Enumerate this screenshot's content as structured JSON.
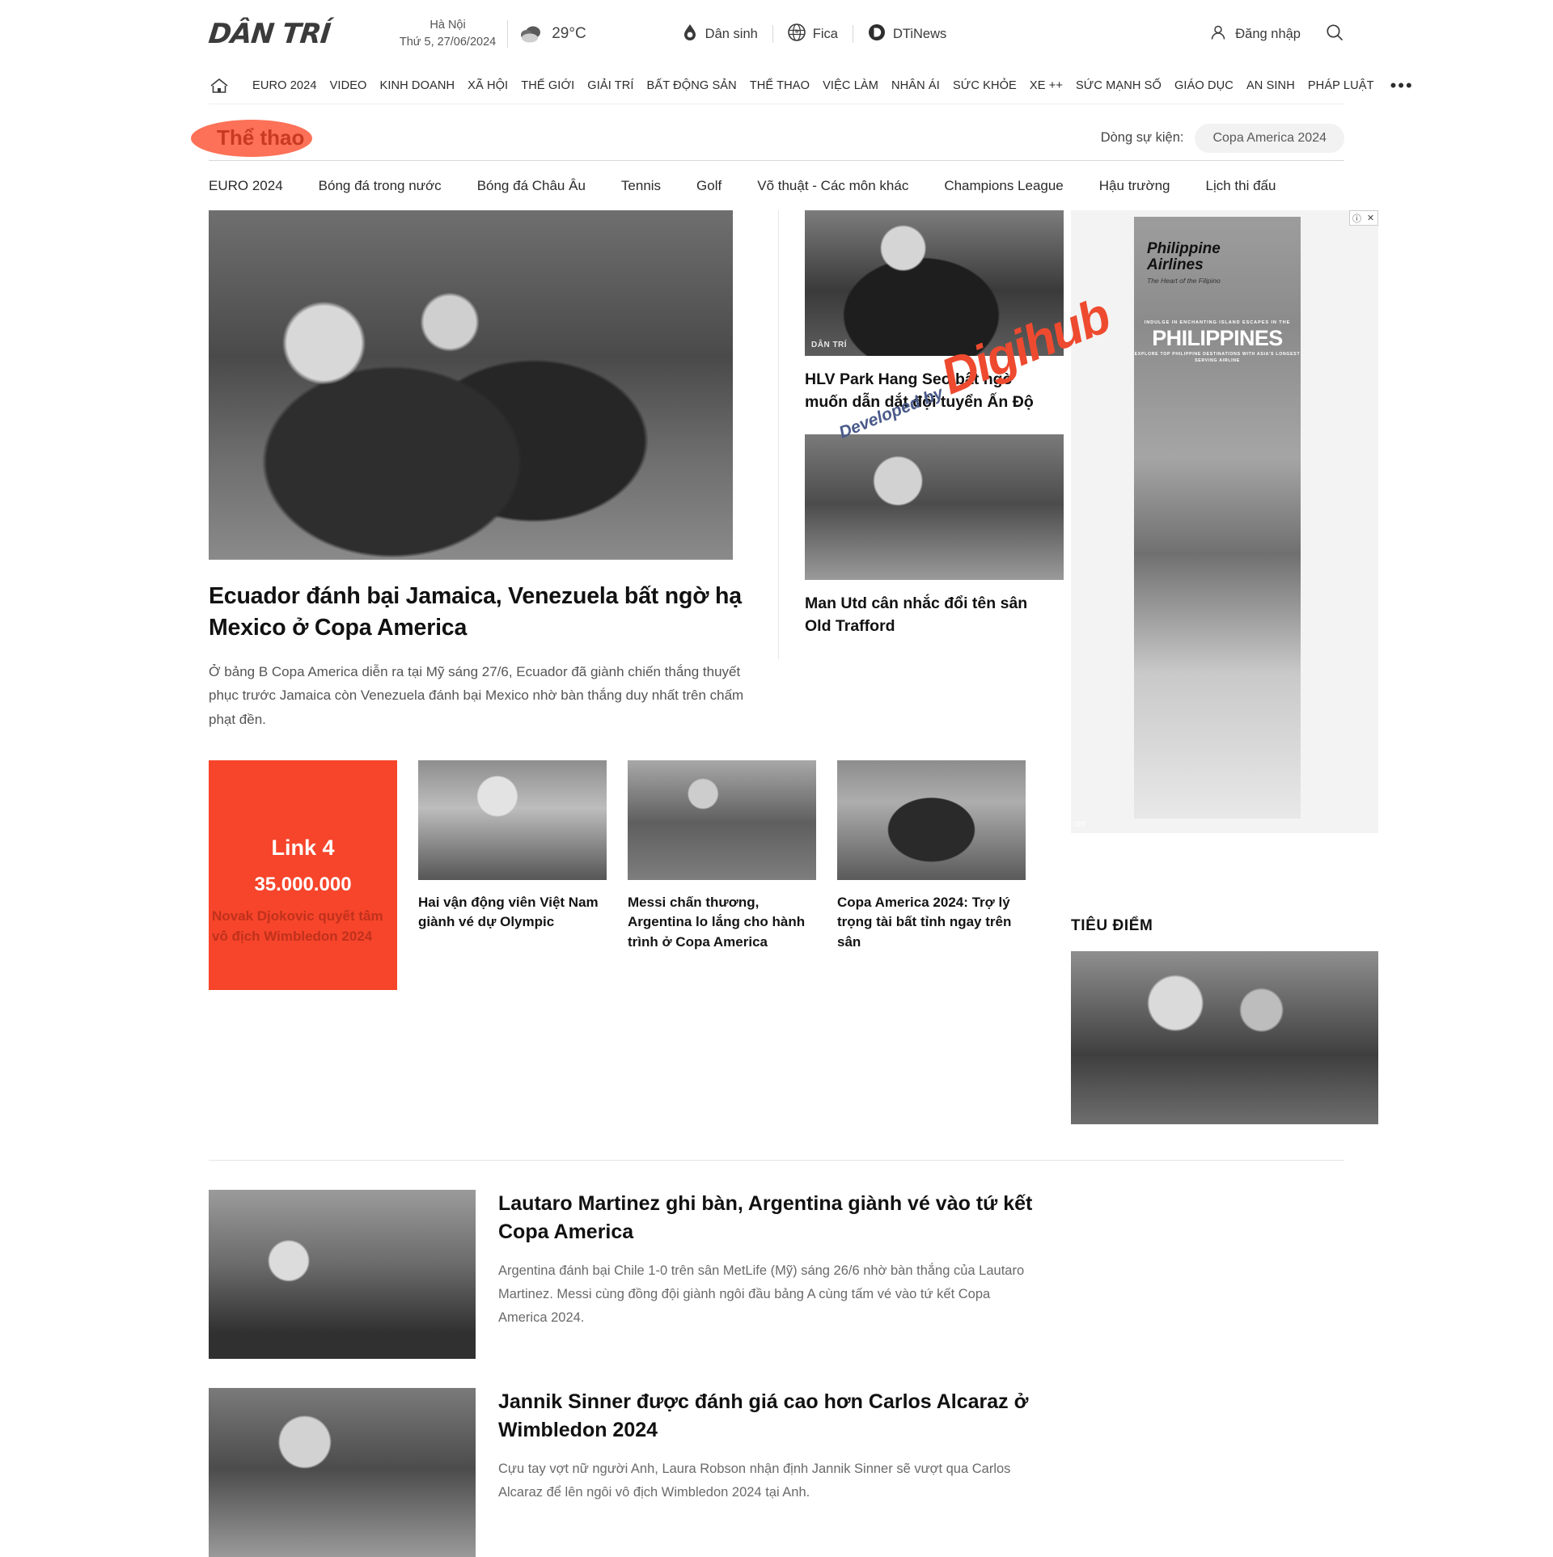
{
  "header": {
    "logo": "DÂN TRÍ",
    "weather": {
      "city": "Hà Nội",
      "date": "Thứ 5, 27/06/2024",
      "temp": "29°C",
      "icon": "cloud-icon"
    },
    "partners": [
      {
        "label": "Dân sinh",
        "icon": "dansinh-icon"
      },
      {
        "label": "Fica",
        "icon": "globe-icon"
      },
      {
        "label": "DTiNews",
        "icon": "dtinews-icon"
      }
    ],
    "login_label": "Đăng nhập",
    "login_icon": "user-icon",
    "search_icon": "search-icon"
  },
  "mainnav": {
    "home_icon": "home-icon",
    "items": [
      "EURO 2024",
      "VIDEO",
      "KINH DOANH",
      "XÃ HỘI",
      "THẾ GIỚI",
      "GIẢI TRÍ",
      "BẤT ĐỘNG SẢN",
      "THỂ THAO",
      "VIỆC LÀM",
      "NHÂN ÁI",
      "SỨC KHỎE",
      "XE ++",
      "SỨC MẠNH SỐ",
      "GIÁO DỤC",
      "AN SINH",
      "PHÁP LUẬT"
    ],
    "more": "•••"
  },
  "section": {
    "title": "Thể thao",
    "event_label": "Dòng sự kiện:",
    "event_chip": "Copa America 2024",
    "highlight_color": "#fb5232"
  },
  "subnav": {
    "items": [
      "EURO 2024",
      "Bóng đá trong nước",
      "Bóng đá Châu Âu",
      "Tennis",
      "Golf",
      "Võ thuật - Các môn khác",
      "Champions League",
      "Hậu trường",
      "Lịch thi đấu"
    ]
  },
  "hero": {
    "title": "Ecuador đánh bại Jamaica, Venezuela bất ngờ hạ Mexico ở Copa America",
    "sapo": "Ở bảng B Copa America diễn ra tại Mỹ sáng 27/6, Ecuador đã giành chiến thắng thuyết phục trước Jamaica còn Venezuela đánh bại Mexico nhờ bàn thắng duy nhất trên chấm phạt đền."
  },
  "mid_cards": [
    {
      "title": "HLV Park Hang Seo bất ngờ muốn dẫn dắt đội tuyển Ấn Độ",
      "badge": "DÂN TRÍ"
    },
    {
      "title": "Man Utd cân nhắc đổi tên sân Old Trafford",
      "badge": ""
    }
  ],
  "ad": {
    "info_icon": "info-icon",
    "close_icon": "close-icon",
    "brand_line1": "Philippine",
    "brand_line2": "Airlines",
    "tagline": "The Heart of the Filipino",
    "kicker": "INDULGE IN ENCHANTING ISLAND ESCAPES IN THE",
    "headline": "PHILIPPINES",
    "subline": "EXPLORE TOP PHILIPPINE DESTINATIONS WITH ASIA'S LONGEST SERVING AIRLINE",
    "corner_badge": "DT"
  },
  "watermark": {
    "prefix": "Developed by",
    "brand": "Digihub",
    "color": "#ee4a2f"
  },
  "promo": {
    "link_label": "Link 4",
    "price": "35.000.000",
    "title": "Novak Djokovic quyết tâm vô địch Wimbledon 2024",
    "bg_color": "#f5462b"
  },
  "thumbs": [
    {
      "title": "Hai vận động viên Việt Nam giành vé dự Olympic"
    },
    {
      "title": "Messi chấn thương, Argentina lo lắng cho hành trình ở Copa America"
    },
    {
      "title": "Copa America 2024: Trợ lý trọng tài bất tỉnh ngay trên sân"
    }
  ],
  "articles": [
    {
      "title": "Lautaro Martinez ghi bàn, Argentina giành vé vào tứ kết Copa America",
      "sapo": "Argentina đánh bại Chile 1-0 trên sân MetLife (Mỹ) sáng 26/6 nhờ bàn thắng của Lautaro Martinez. Messi cùng đồng đội giành ngôi đầu bảng A cùng tấm vé vào tứ kết Copa America 2024."
    },
    {
      "title": "Jannik Sinner được đánh giá cao hơn Carlos Alcaraz ở Wimbledon 2024",
      "sapo": "Cựu tay vợt nữ người Anh, Laura Robson nhận định Jannik Sinner sẽ vượt qua Carlos Alcaraz để lên ngôi vô địch Wimbledon 2024 tại Anh."
    }
  ],
  "sidebar": {
    "focus_heading": "TIÊU ĐIỂM"
  }
}
